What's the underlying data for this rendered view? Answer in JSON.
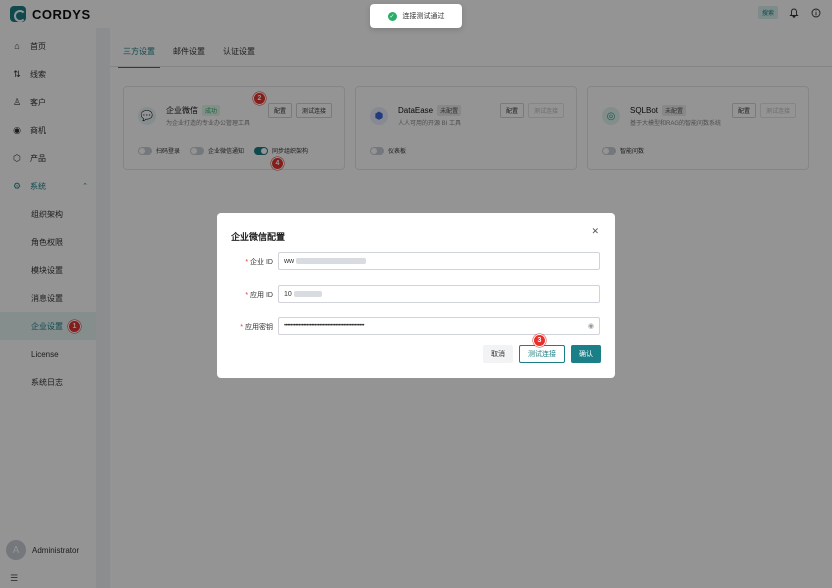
{
  "app": {
    "logo_text": "CORDYS",
    "search_label": "搜索"
  },
  "sidebar": {
    "items": [
      {
        "label": "首页",
        "icon": "home-icon"
      },
      {
        "label": "线索",
        "icon": "lead-icon"
      },
      {
        "label": "客户",
        "icon": "customer-icon"
      },
      {
        "label": "商机",
        "icon": "opportunity-icon"
      },
      {
        "label": "产品",
        "icon": "product-icon"
      },
      {
        "label": "系统",
        "icon": "system-icon"
      }
    ],
    "sub_items": [
      {
        "label": "组织架构"
      },
      {
        "label": "角色权限"
      },
      {
        "label": "模块设置"
      },
      {
        "label": "消息设置"
      },
      {
        "label": "企业设置"
      },
      {
        "label": "License"
      },
      {
        "label": "系统日志"
      }
    ],
    "user": {
      "avatar_letter": "A",
      "name": "Administrator"
    }
  },
  "tabs": [
    {
      "label": "三方设置"
    },
    {
      "label": "邮件设置"
    },
    {
      "label": "认证设置"
    }
  ],
  "cards": [
    {
      "title": "企业微信",
      "status": "成功",
      "desc": "为企业打造的专业办公管理工具",
      "config_label": "配置",
      "test_label": "测试连接",
      "toggles": [
        {
          "label": "扫码登录",
          "on": false
        },
        {
          "label": "企业微信通知",
          "on": false
        },
        {
          "label": "同步组织架构",
          "on": true
        }
      ]
    },
    {
      "title": "DataEase",
      "status": "未配置",
      "desc": "人人可用的开源 BI 工具",
      "config_label": "配置",
      "test_label": "测试连接",
      "toggles": [
        {
          "label": "仪表板",
          "on": false
        }
      ]
    },
    {
      "title": "SQLBot",
      "status": "未配置",
      "desc": "基于大模型和RAG的智能问数系统",
      "config_label": "配置",
      "test_label": "测试连接",
      "toggles": [
        {
          "label": "智能问数",
          "on": false
        }
      ]
    }
  ],
  "toast": {
    "message": "连接测试通过"
  },
  "dialog": {
    "title": "企业微信配置",
    "fields": [
      {
        "label": "企业 ID",
        "value": "ww"
      },
      {
        "label": "应用 ID",
        "value": "10"
      },
      {
        "label": "应用密钥",
        "value": "••••••••••••••••••••••••••••••••••••••••••••••••••"
      }
    ],
    "cancel_label": "取消",
    "test_label": "测试连接",
    "confirm_label": "确认"
  },
  "markers": {
    "m1": "1",
    "m2": "2",
    "m3": "3",
    "m4": "4"
  },
  "colors": {
    "accent": "#1a7f86",
    "success": "#2aae67",
    "marker": "#e5322d"
  }
}
